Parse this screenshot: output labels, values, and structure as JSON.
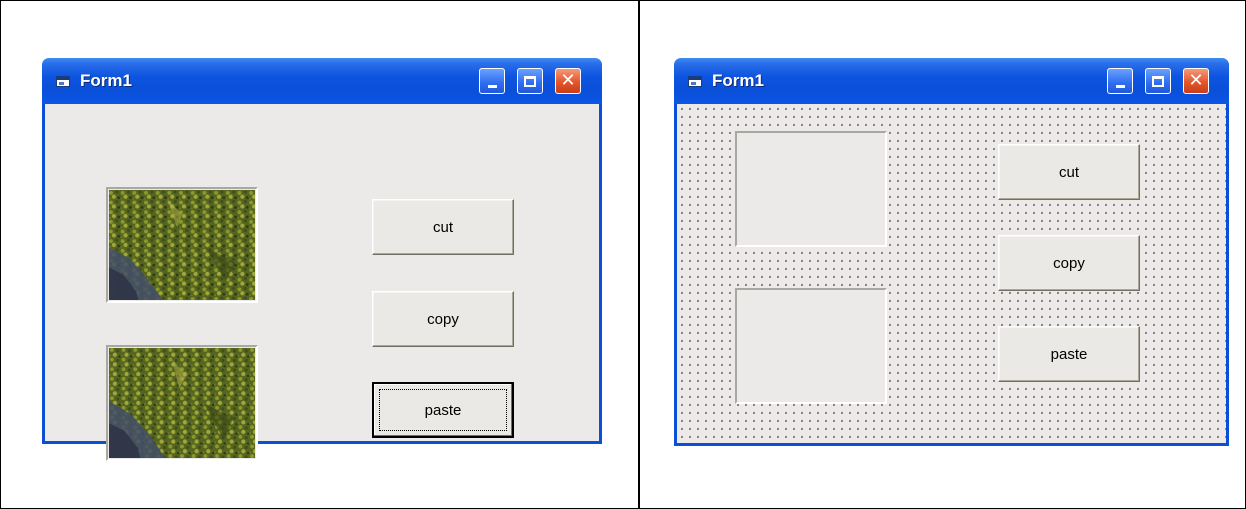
{
  "windows": [
    {
      "title": "Form1",
      "mode": "runtime",
      "buttons": [
        {
          "label": "cut"
        },
        {
          "label": "copy"
        },
        {
          "label": "paste",
          "focused": true
        }
      ],
      "picture_boxes": [
        {
          "content": "grass-photo"
        },
        {
          "content": "grass-photo"
        }
      ]
    },
    {
      "title": "Form1",
      "mode": "design",
      "buttons": [
        {
          "label": "cut"
        },
        {
          "label": "copy"
        },
        {
          "label": "paste"
        }
      ],
      "picture_boxes": [
        {
          "content": "empty"
        },
        {
          "content": "empty"
        }
      ]
    }
  ],
  "icons": {
    "form_icon": "form-icon",
    "minimize": "minimize-icon",
    "maximize": "maximize-icon",
    "close": "close-icon"
  },
  "colors": {
    "titlebar": "#0b4fd6",
    "client": "#ece9e9",
    "close_button": "#e3562c"
  }
}
